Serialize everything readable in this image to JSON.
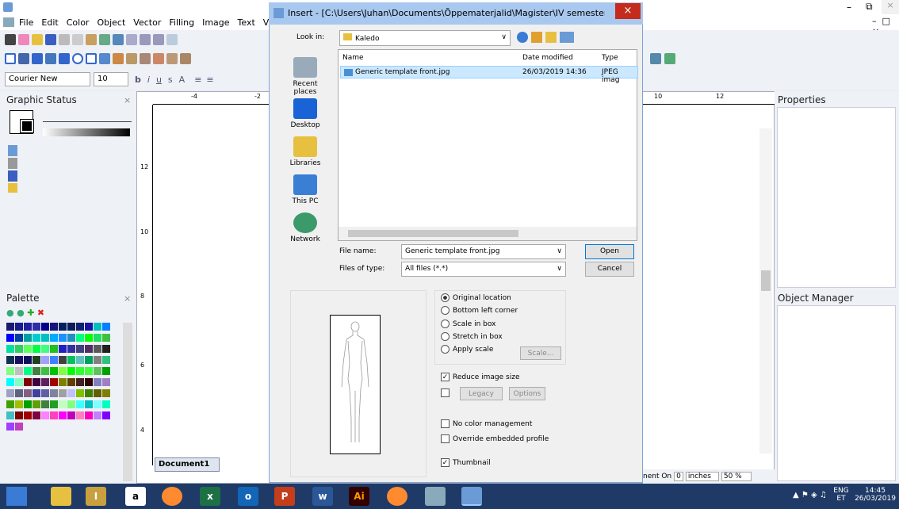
{
  "app": {
    "menu": [
      "File",
      "Edit",
      "Color",
      "Object",
      "Vector",
      "Filling",
      "Image",
      "Text",
      "V"
    ],
    "font_name": "Courier New",
    "font_size": "10"
  },
  "panels": {
    "graphic_status": "Graphic Status",
    "palette": "Palette",
    "properties": "Properties",
    "object_manager": "Object Manager"
  },
  "document": {
    "tab": "Document1",
    "status_prefix": "nent On",
    "status_value": "0",
    "unit": "inches",
    "zoom": "50 %"
  },
  "ruler": {
    "top": [
      "-4",
      "-2",
      "10",
      "12"
    ],
    "left": [
      "12",
      "10",
      "8",
      "6",
      "4"
    ]
  },
  "dialog": {
    "title": "Insert - [C:\\Users\\Juhan\\Documents\\Õppematerjalid\\Magister\\IV semester...",
    "look_in_label": "Look in:",
    "look_in_value": "Kaledo",
    "columns": [
      "Name",
      "Date modified",
      "Type"
    ],
    "files": [
      {
        "name": "Generic template front.jpg",
        "date": "26/03/2019 14:36",
        "type": "JPEG imag"
      }
    ],
    "places": [
      "Recent places",
      "Desktop",
      "Libraries",
      "This PC",
      "Network"
    ],
    "file_name_label": "File name:",
    "file_name_value": "Generic template front.jpg",
    "file_type_label": "Files of type:",
    "file_type_value": "All files (*.*)",
    "open": "Open",
    "cancel": "Cancel",
    "options": {
      "original": "Original location",
      "bottom_left": "Bottom left corner",
      "scale_box": "Scale in box",
      "stretch_box": "Stretch in box",
      "apply_scale": "Apply scale",
      "scale_btn": "Scale...",
      "reduce": "Reduce image size",
      "legacy": "Legacy",
      "options_btn": "Options",
      "no_color": "No color management",
      "override": "Override embedded profile",
      "thumbnail": "Thumbnail"
    }
  },
  "taskbar": {
    "lang": "ENG",
    "lang_sub": "ET",
    "time": "14:45",
    "date": "26/03/2019"
  },
  "palette_colors": [
    "#1a1a6e",
    "#1a1a8a",
    "#2020a0",
    "#2d2daa",
    "#00008b",
    "#14147a",
    "#002060",
    "#0a1a5a",
    "#102070",
    "#1515a0",
    "#00bfbf",
    "#0080ff",
    "#0000ff",
    "#0040a0",
    "#00a0a0",
    "#00cccc",
    "#00c0c0",
    "#00aaff",
    "#1e90ff",
    "#2090c0",
    "#00ff80",
    "#00ff00",
    "#20e060",
    "#40c040",
    "#00e0a0",
    "#30d060",
    "#60ff60",
    "#00ff40",
    "#40ff80",
    "#20c020",
    "#2020c0",
    "#3030a0",
    "#404080",
    "#503060",
    "#5a5a5a",
    "#202020",
    "#103050",
    "#181060",
    "#101060",
    "#204020",
    "#a0a0ff",
    "#4080ff",
    "#404040",
    "#00c060",
    "#60c0c0",
    "#00a060",
    "#808080",
    "#30c080",
    "#80ff80",
    "#c0c0c0",
    "#00ff80",
    "#408040",
    "#40c040",
    "#00c000",
    "#80ff40",
    "#00ff00",
    "#30ff30",
    "#40ff40",
    "#60c060",
    "#00a000",
    "#00ffff",
    "#80ffc0",
    "#800000",
    "#400040",
    "#602060",
    "#a00000",
    "#808000",
    "#604000",
    "#402020",
    "#300000",
    "#8080c0",
    "#a080c0",
    "#a0a0c0",
    "#606080",
    "#806080",
    "#4040a0",
    "#6060a0",
    "#8080a0",
    "#a0a0a0",
    "#c0c0ff",
    "#80c000",
    "#408000",
    "#606000",
    "#808000",
    "#40a000",
    "#a0c000",
    "#00a000",
    "#60a000",
    "#408040",
    "#20a020",
    "#c0ffc0",
    "#80ff80",
    "#40ffff",
    "#00c0c0",
    "#80ffff",
    "#00ffc0",
    "#40c0c0",
    "#800000",
    "#a00000",
    "#800040",
    "#ff80ff",
    "#ff40c0",
    "#ff00ff",
    "#c000c0",
    "#ff80c0",
    "#ff00c0",
    "#c080ff",
    "#8000ff",
    "#a040ff",
    "#c040c0"
  ]
}
